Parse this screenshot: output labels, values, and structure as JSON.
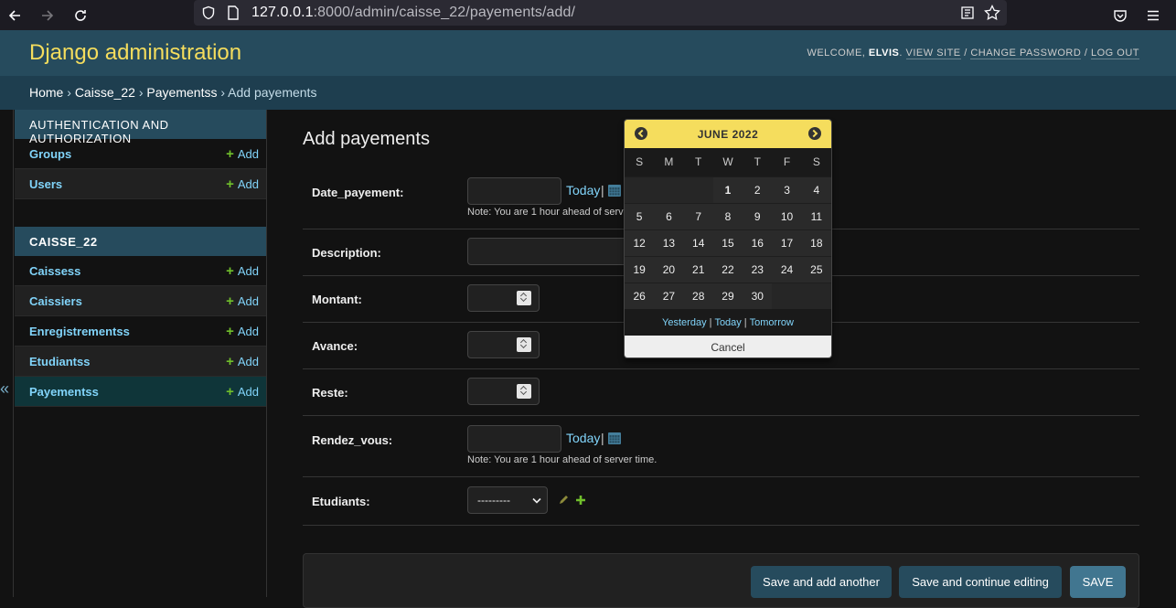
{
  "browser": {
    "url_host": "127.0.0.1",
    "url_rest": ":8000/admin/caisse_22/payements/add/"
  },
  "header": {
    "branding": "Django administration",
    "welcome": "WELCOME,",
    "user": "ELVIS",
    "view_site": "VIEW SITE",
    "change_password": "CHANGE PASSWORD",
    "log_out": "LOG OUT"
  },
  "breadcrumbs": {
    "home": "Home",
    "app": "Caisse_22",
    "model": "Payementss",
    "current": "Add payements",
    "sep": "›"
  },
  "sidebar": {
    "toggle": "«",
    "modules": [
      {
        "caption": "AUTHENTICATION AND AUTHORIZATION",
        "items": [
          {
            "label": "Groups",
            "add": "Add"
          },
          {
            "label": "Users",
            "add": "Add"
          }
        ]
      },
      {
        "caption": "CAISSE_22",
        "items": [
          {
            "label": "Caissess",
            "add": "Add"
          },
          {
            "label": "Caissiers",
            "add": "Add"
          },
          {
            "label": "Enregistrementss",
            "add": "Add"
          },
          {
            "label": "Etudiantss",
            "add": "Add"
          },
          {
            "label": "Payementss",
            "add": "Add"
          }
        ]
      }
    ]
  },
  "form": {
    "title": "Add payements",
    "date_payement": {
      "label": "Date_payement:",
      "today": "Today",
      "sep": "|",
      "note": "Note: You are 1 hour ahead of server time."
    },
    "description": {
      "label": "Description:"
    },
    "montant": {
      "label": "Montant:"
    },
    "avance": {
      "label": "Avance:"
    },
    "reste": {
      "label": "Reste:"
    },
    "rendez_vous": {
      "label": "Rendez_vous:",
      "today": "Today",
      "sep": "|",
      "note": "Note: You are 1 hour ahead of server time."
    },
    "etudiants": {
      "label": "Etudiants:",
      "selected": "---------"
    }
  },
  "submit": {
    "save_add_another": "Save and add another",
    "save_continue": "Save and continue editing",
    "save": "SAVE"
  },
  "calendar": {
    "caption": "JUNE 2022",
    "days": [
      "S",
      "M",
      "T",
      "W",
      "T",
      "F",
      "S"
    ],
    "weeks": [
      [
        "",
        "",
        "",
        "1",
        "2",
        "3",
        "4"
      ],
      [
        "5",
        "6",
        "7",
        "8",
        "9",
        "10",
        "11"
      ],
      [
        "12",
        "13",
        "14",
        "15",
        "16",
        "17",
        "18"
      ],
      [
        "19",
        "20",
        "21",
        "22",
        "23",
        "24",
        "25"
      ],
      [
        "26",
        "27",
        "28",
        "29",
        "30",
        "",
        ""
      ]
    ],
    "today_day": "1",
    "yesterday": "Yesterday",
    "today": "Today",
    "tomorrow": "Tomorrow",
    "sep": "|",
    "cancel": "Cancel"
  },
  "colors": {
    "header_bg": "#264b5d",
    "branding": "#f5dd5d",
    "link": "#81d4fa",
    "add_plus": "#70bf2b",
    "calendar_caption": "#f5dd5d"
  }
}
